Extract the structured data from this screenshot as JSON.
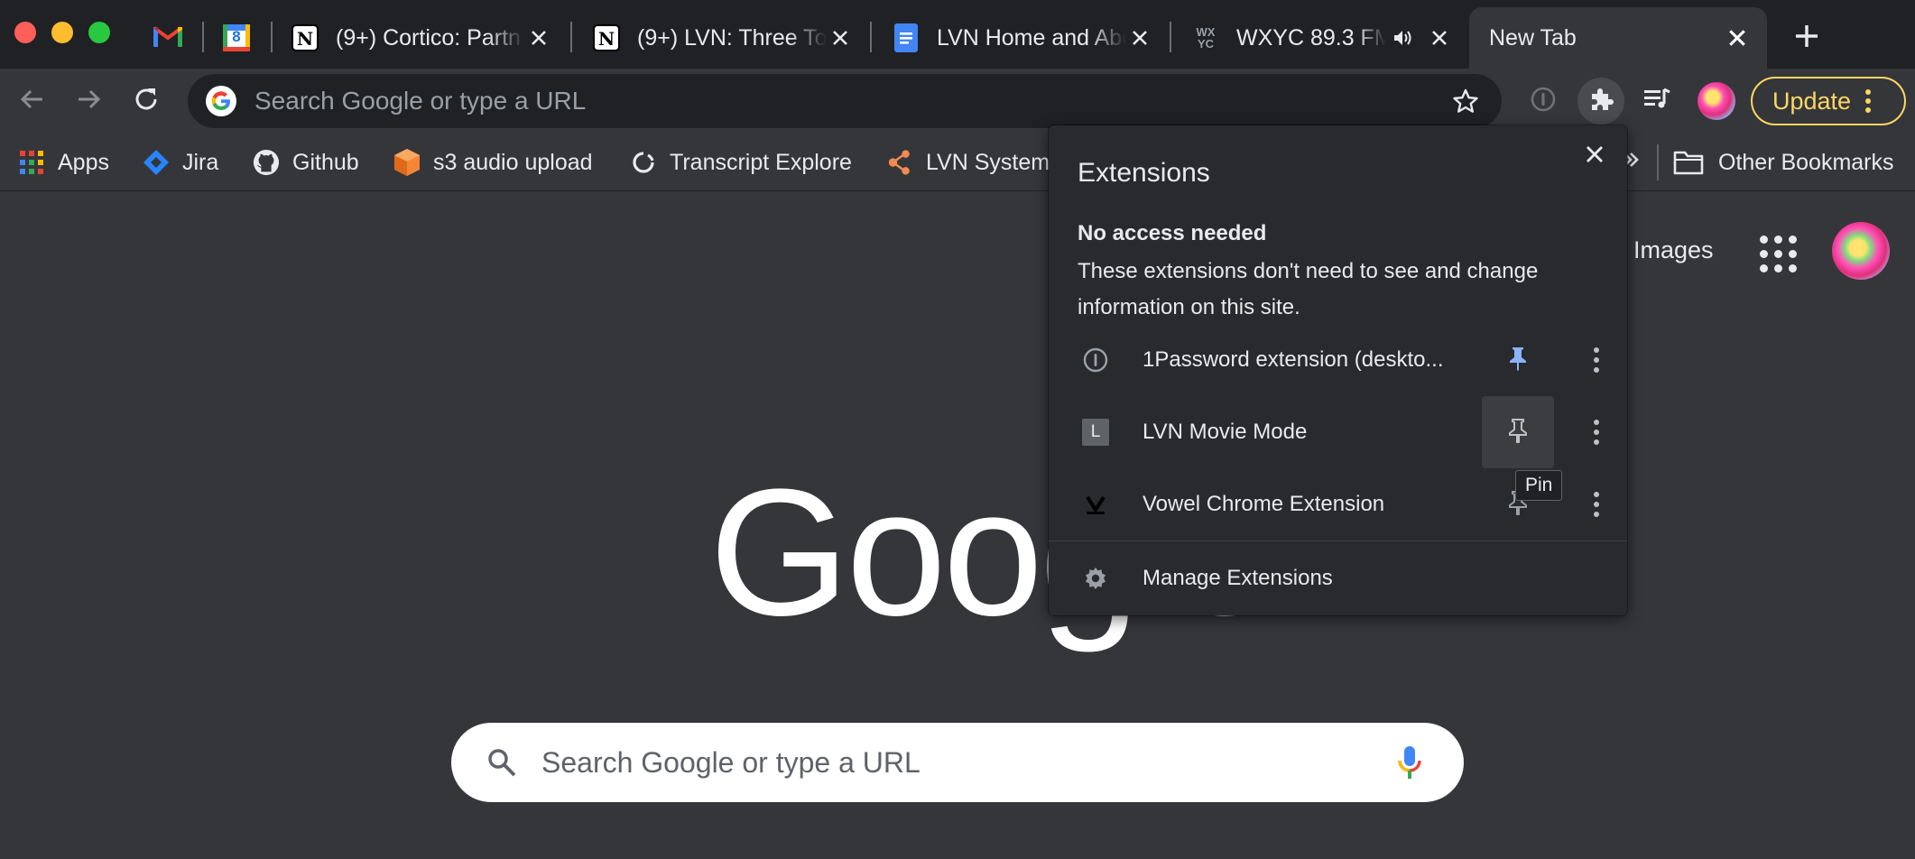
{
  "tabs": [
    {
      "title": "",
      "icon": "gmail-icon"
    },
    {
      "title": "",
      "icon": "calendar-icon",
      "calendar_day": "8"
    },
    {
      "title": "(9+) Cortico: Partn",
      "icon": "notion-icon"
    },
    {
      "title": "(9+) LVN: Three To",
      "icon": "notion-icon"
    },
    {
      "title": "LVN Home and Abo",
      "icon": "docs-icon"
    },
    {
      "title": "WXYC 89.3 FM",
      "icon": "wxyc-icon",
      "favicon_text": "WX YC"
    },
    {
      "title": "New Tab",
      "icon": "",
      "active": true
    }
  ],
  "toolbar": {
    "omnibox_placeholder": "Search Google or type a URL",
    "update_label": "Update"
  },
  "bookmarks": [
    {
      "label": "Apps",
      "icon": "apps-grid-icon"
    },
    {
      "label": "Jira",
      "icon": "jira-icon"
    },
    {
      "label": "Github",
      "icon": "github-icon"
    },
    {
      "label": "s3 audio upload",
      "icon": "s3-icon"
    },
    {
      "label": "Transcript Explore",
      "icon": "transcript-icon"
    },
    {
      "label": "LVN System",
      "icon": "lvn-system-icon"
    },
    {
      "label": "Other Bookmarks",
      "icon": "folder-icon"
    }
  ],
  "page": {
    "images_link": "Images",
    "logo_text": "Google",
    "search_placeholder": "Search Google or type a URL"
  },
  "extensions_popup": {
    "title": "Extensions",
    "section_title": "No access needed",
    "section_desc": "These extensions don't need to see and change information on this site.",
    "items": [
      {
        "name": "1Password extension (deskto...",
        "pinned": true,
        "icon": "onepassword-icon"
      },
      {
        "name": "LVN Movie Mode",
        "pinned": false,
        "icon": "lvn-movie-mode-icon",
        "icon_letter": "L"
      },
      {
        "name": "Vowel Chrome Extension",
        "pinned": false,
        "icon": "vowel-icon"
      }
    ],
    "manage_label": "Manage Extensions",
    "tooltip": "Pin"
  },
  "colors": {
    "frame": "#202124",
    "toolbar": "#35363a",
    "popup": "#292a2d",
    "update_accent": "#fdd663",
    "pin_active": "#8ab4f8"
  }
}
